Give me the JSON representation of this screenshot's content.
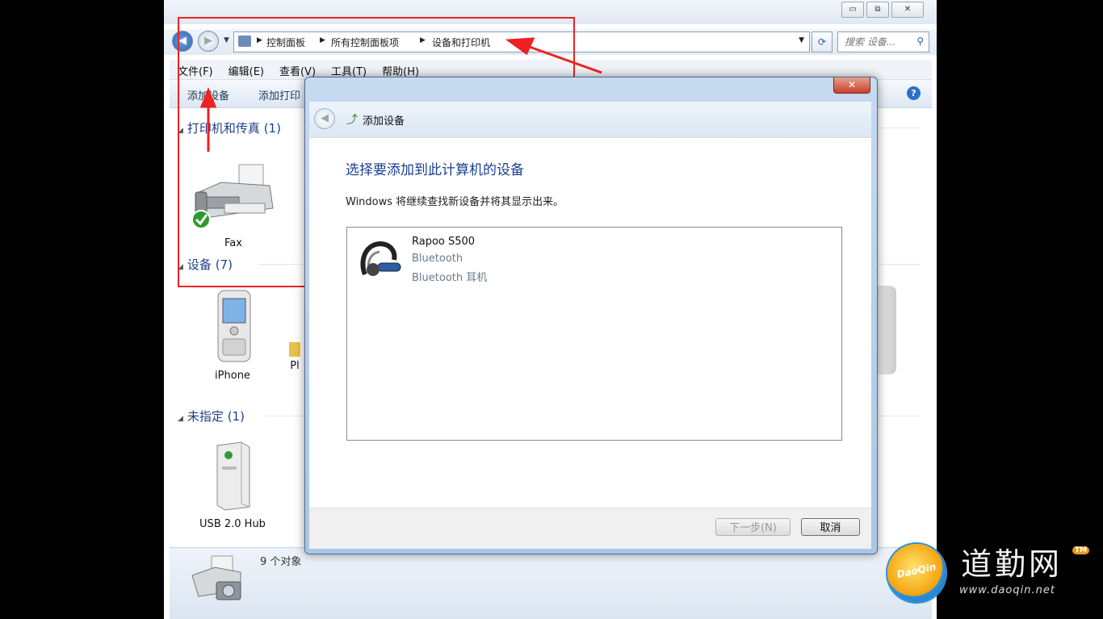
{
  "window": {
    "minimize_glyph": "▭",
    "maximize_glyph": "⧉",
    "close_glyph": "✕"
  },
  "address": {
    "crumbs": [
      "控制面板",
      "所有控制面板项",
      "设备和打印机"
    ],
    "search_placeholder": "搜索 设备..."
  },
  "menu": [
    "文件(F)",
    "编辑(E)",
    "查看(V)",
    "工具(T)",
    "帮助(H)"
  ],
  "commands": {
    "add_device": "添加设备",
    "add_printer": "添加打印"
  },
  "groups": {
    "printers": {
      "header": "打印机和传真 (1)",
      "items": [
        {
          "label": "Fax",
          "icon": "fax-icon"
        }
      ]
    },
    "devices": {
      "header": "设备 (7)",
      "items": [
        {
          "label": "iPhone",
          "icon": "phone-icon"
        },
        {
          "label": "Pl",
          "icon": "device-icon"
        }
      ]
    },
    "unspecified": {
      "header": "未指定 (1)",
      "items": [
        {
          "label": "USB 2.0 Hub",
          "icon": "usb-hub-icon"
        }
      ]
    }
  },
  "status": {
    "count": "9 个对象"
  },
  "dialog": {
    "title": "添加设备",
    "heading": "选择要添加到此计算机的设备",
    "subtitle": "Windows 将继续查找新设备并将其显示出来。",
    "devices": [
      {
        "name": "Rapoo S500",
        "type": "Bluetooth",
        "category": "Bluetooth 耳机",
        "icon": "headset-icon"
      }
    ],
    "next_button": "下一步(N)",
    "cancel_button": "取消"
  },
  "watermark": {
    "logo_text": "DaoQin",
    "brand": "道勤网",
    "tm": "TM",
    "url": "www.daoqin.net"
  },
  "colors": {
    "annotation": "#e22222",
    "group_header": "#1e3f8a",
    "dialog_heading": "#1b3f8f"
  }
}
